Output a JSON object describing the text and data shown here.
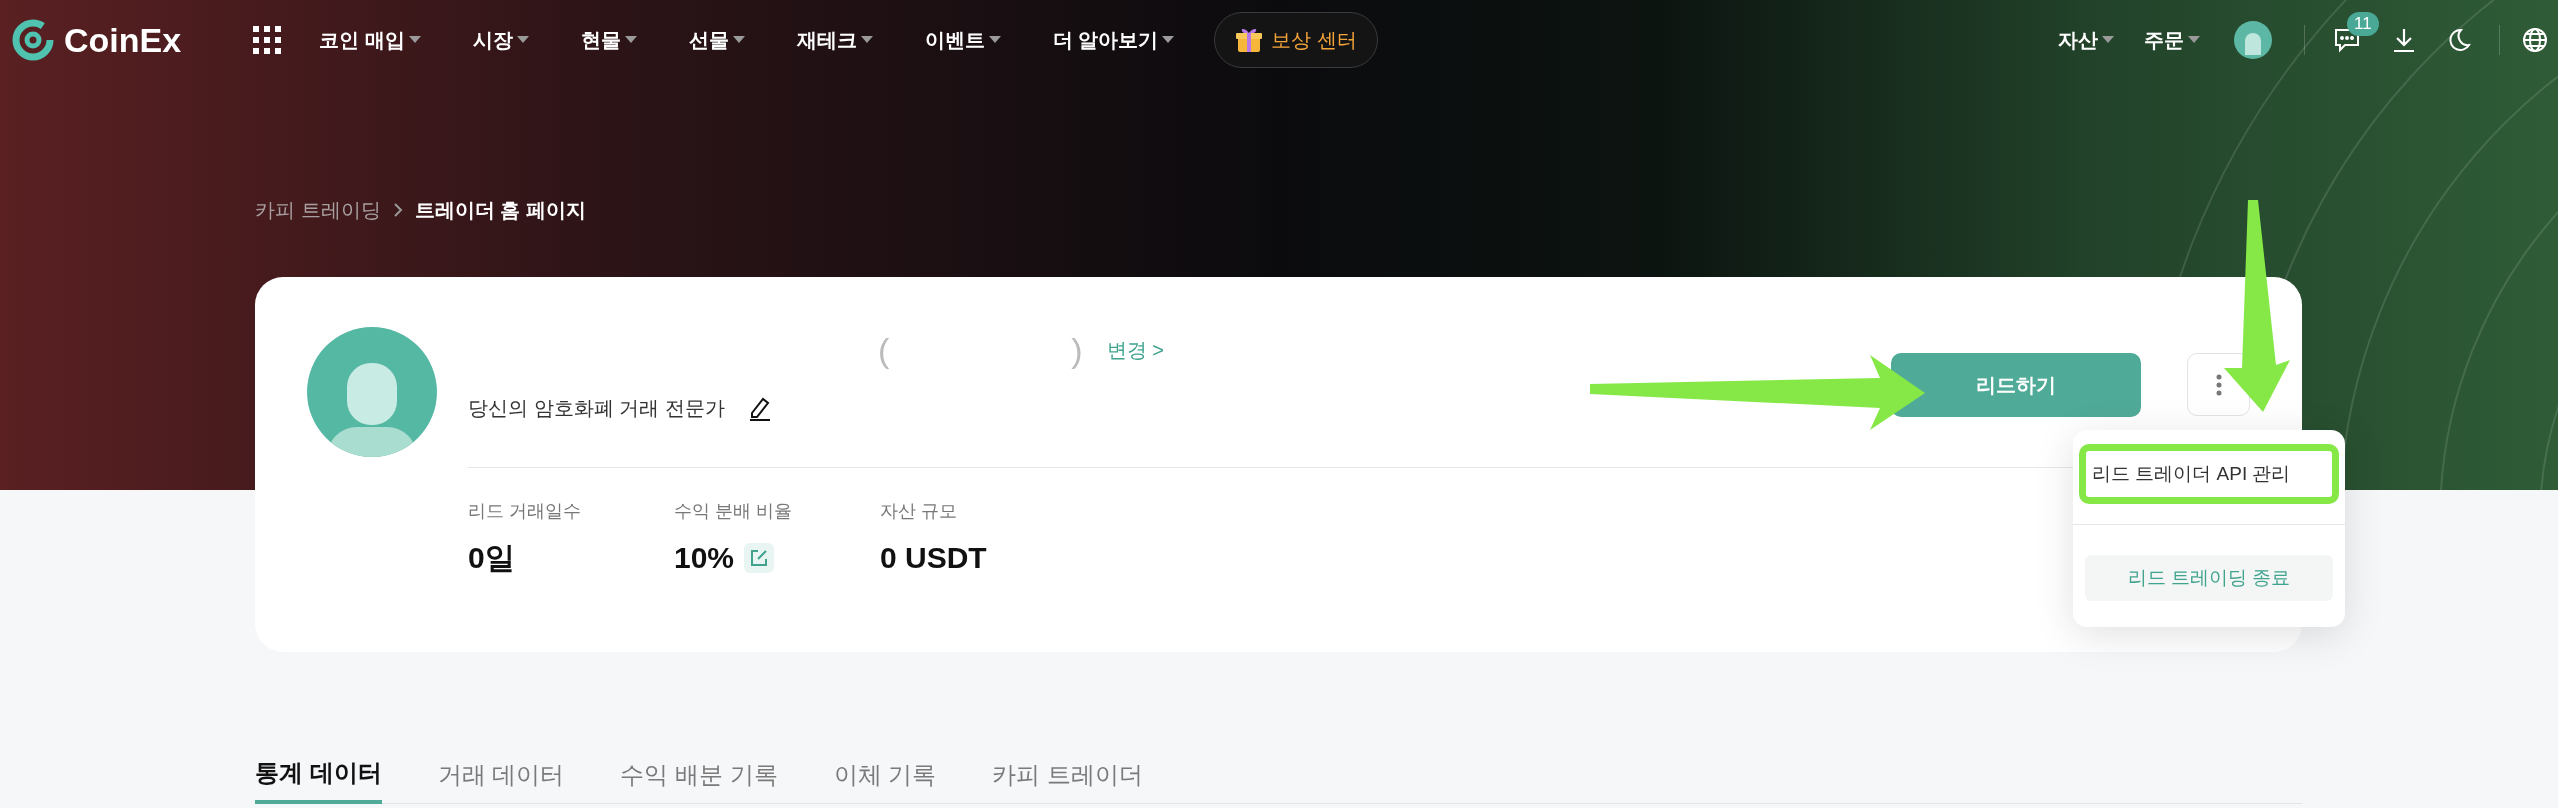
{
  "nav": {
    "logo": "CoinEx",
    "menu": [
      {
        "label": "코인 매입"
      },
      {
        "label": "시장"
      },
      {
        "label": "현물"
      },
      {
        "label": "선물"
      },
      {
        "label": "재테크"
      },
      {
        "label": "이벤트"
      },
      {
        "label": "더 알아보기"
      }
    ],
    "reward": "보상 센터",
    "right_menu": [
      {
        "label": "자산"
      },
      {
        "label": "주문"
      }
    ],
    "notification_count": "11"
  },
  "breadcrumb": [
    {
      "label": "카피 트레이딩",
      "current": false
    },
    {
      "label": "트레이더 홈 페이지",
      "current": true
    }
  ],
  "profile": {
    "name_open": "(",
    "name_close": ")",
    "change_link": "변경 >",
    "bio": "당신의 암호화폐 거래 전문가",
    "stats": [
      {
        "label": "리드 거래일수",
        "value": "0일",
        "editable": false
      },
      {
        "label": "수익 분배 비율",
        "value": "10%",
        "editable": true
      },
      {
        "label": "자산 규모",
        "value": "0 USDT",
        "editable": false
      }
    ]
  },
  "primary_button": "리드하기",
  "dropdown": {
    "items": [
      {
        "label": "리드 트레이더 API 관리",
        "kind": "plain",
        "highlighted": true
      },
      {
        "label": "리드 트레이딩 종료",
        "kind": "button",
        "highlighted": false
      }
    ]
  },
  "tabs": [
    {
      "label": "통계 데이터",
      "selected": true
    },
    {
      "label": "거래 데이터",
      "selected": false
    },
    {
      "label": "수익 배분 기록",
      "selected": false
    },
    {
      "label": "이체 기록",
      "selected": false
    },
    {
      "label": "카피 트레이더",
      "selected": false
    }
  ]
}
